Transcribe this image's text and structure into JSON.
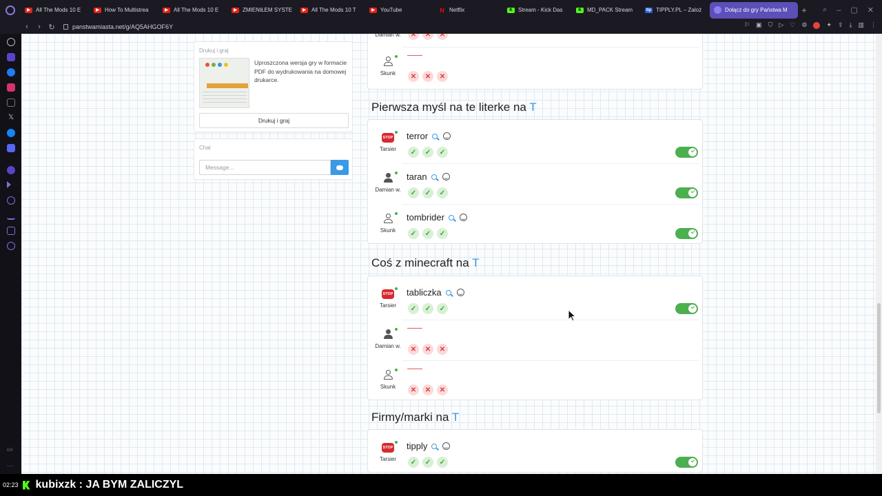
{
  "browser": {
    "tabs": [
      {
        "label": "All The Mods 10 E",
        "icon": "youtube-icon"
      },
      {
        "label": "How To Multistrea",
        "icon": "youtube-icon"
      },
      {
        "label": "All The Mods 10 E",
        "icon": "youtube-icon"
      },
      {
        "label": "ZMIENIŁEM SYSTE",
        "icon": "youtube-icon"
      },
      {
        "label": "All The Mods 10 T",
        "icon": "youtube-icon"
      },
      {
        "label": "YouTube",
        "icon": "youtube-icon"
      },
      {
        "label": "Netflix",
        "icon": "netflix-icon"
      },
      {
        "label": "Stream - Kick Das",
        "icon": "kick-icon"
      },
      {
        "label": "MD_PACK Stream",
        "icon": "kick-icon"
      },
      {
        "label": "TIPPLY.PL – Zaloż",
        "icon": "tipply-icon"
      },
      {
        "label": "Dołącz do gry Państwa M",
        "icon": "panstwa-miasta-icon",
        "active": true
      }
    ],
    "url": "panstwamiasta.net/g/AQ5AHGOF6Y"
  },
  "print_card": {
    "title": "Drukuj i graj",
    "description": "Uproszczona wersja gry w formacie PDF do wydrukowania na domowej drukarce.",
    "button": "Drukuj i graj"
  },
  "chat_card": {
    "title": "Chat",
    "placeholder": "Message..."
  },
  "top_section": {
    "rows": [
      {
        "player": "Damian w.",
        "answer": "",
        "votes": [
          "no",
          "no",
          "no"
        ]
      },
      {
        "player": "Skunk",
        "answer": "",
        "votes": [
          "no",
          "no",
          "no"
        ]
      }
    ]
  },
  "categories": [
    {
      "title": "Pierwsza myśl na te literke na",
      "letter": "T",
      "rows": [
        {
          "player": "Tarsier",
          "answer": "terror",
          "votes": [
            "ok",
            "ok",
            "ok"
          ],
          "accepted": true
        },
        {
          "player": "Damian w.",
          "answer": "taran",
          "votes": [
            "ok",
            "ok",
            "ok"
          ],
          "accepted": true
        },
        {
          "player": "Skunk",
          "answer": "tombrider",
          "votes": [
            "ok",
            "ok",
            "ok"
          ],
          "accepted": true
        }
      ]
    },
    {
      "title": "Coś z minecraft na",
      "letter": "T",
      "rows": [
        {
          "player": "Tarsier",
          "answer": "tabliczka",
          "votes": [
            "ok",
            "ok",
            "ok"
          ],
          "accepted": true
        },
        {
          "player": "Damian w.",
          "answer": "",
          "votes": [
            "no",
            "no",
            "no"
          ],
          "accepted": false
        },
        {
          "player": "Skunk",
          "answer": "",
          "votes": [
            "no",
            "no",
            "no"
          ],
          "accepted": false
        }
      ]
    },
    {
      "title": "Firmy/marki na",
      "letter": "T",
      "rows": [
        {
          "player": "Tarsier",
          "answer": "tipply",
          "votes": [
            "ok",
            "ok",
            "ok"
          ],
          "accepted": true
        }
      ]
    }
  ],
  "stream_overlay": {
    "time": "02:23",
    "chat_message": "kubixzk : JA BYM ZALICZYL"
  },
  "colors": {
    "accent": "#3a9ae6",
    "accept_green": "#4caf50",
    "reject_red": "#e03b3b"
  }
}
